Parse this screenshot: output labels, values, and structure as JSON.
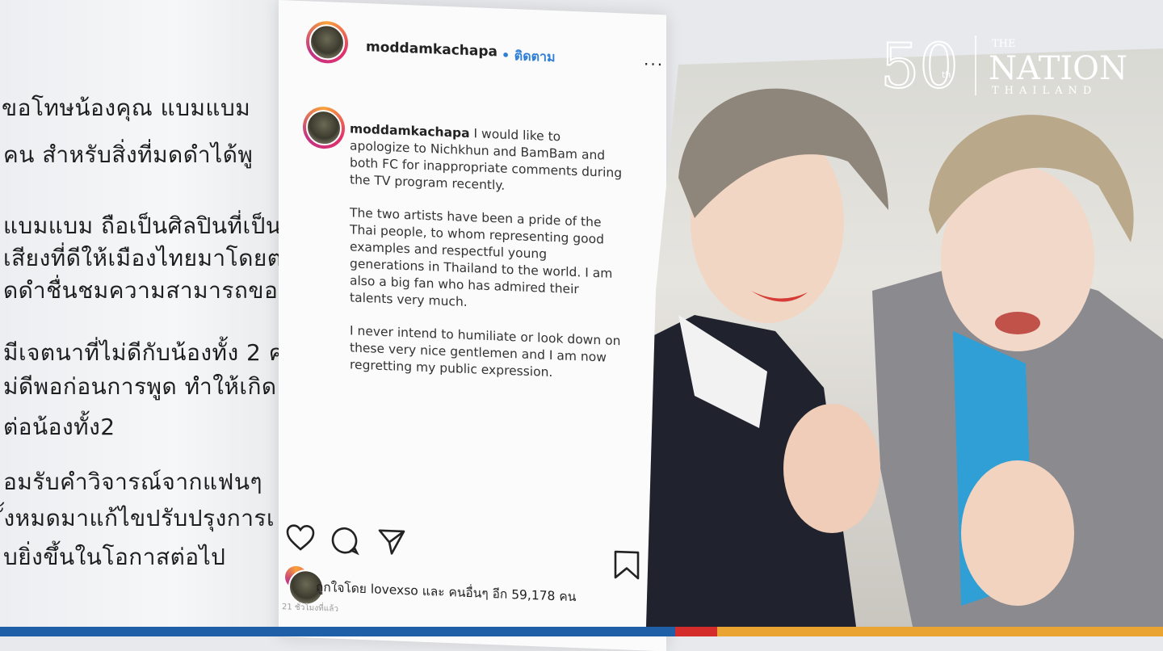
{
  "background_text": {
    "lines": [
      "ขอโทษน้องคุณ แบมแบม",
      "คน สำหรับสิ่งที่มดดำได้พู",
      "แบมแบม ถือเป็นศิลปินที่เป็น",
      "เสียงที่ดีให้เมืองไทยมาโดยต",
      "ดดำชื่นชมความสามารถขอ",
      "มีเจตนาที่ไม่ดีกับน้องทั้ง 2 ค",
      "ม่ดีพอก่อนการพูด ทำให้เกิด",
      "ต่อน้องทั้ง2",
      "อมรับคำวิจารณ์จากแฟนๆ",
      "ั้งหมดมาแก้ไขปรับปรุงการเ",
      "บยิ่งขึ้นในโอกาสต่อไป"
    ]
  },
  "post": {
    "username": "moddamkachapa",
    "follow_label": "• ติดตาม",
    "more_label": "...",
    "caption_user": "moddamkachapa",
    "caption_p1": "I would like to apologize to Nichkhun and BamBam and both FC for inappropriate comments during the TV program recently.",
    "caption_p2": "The two artists have been a pride of the Thai people, to whom representing good examples and respectful young generations in Thailand to the world. I am also a big fan who has admired their talents very much.",
    "caption_p3": "I never intend to humiliate or look down on these very nice gentlemen and I am now regretting my public expression.",
    "likes_text": "ถูกใจโดย lovexso และ คนอื่นๆ อีก 59,178 คน",
    "time_text": "21 ชั่วโมงที่แล้ว"
  },
  "logo": {
    "anniversary": "50",
    "anniversary_suffix": "th",
    "the": "THE",
    "nation": "NATION",
    "thailand": "THAILAND"
  },
  "colors": {
    "follow": "#2f7fd6",
    "bar_blue": "#1f5fa8",
    "bar_red": "#d42b2b",
    "bar_gold": "#e9a431"
  }
}
